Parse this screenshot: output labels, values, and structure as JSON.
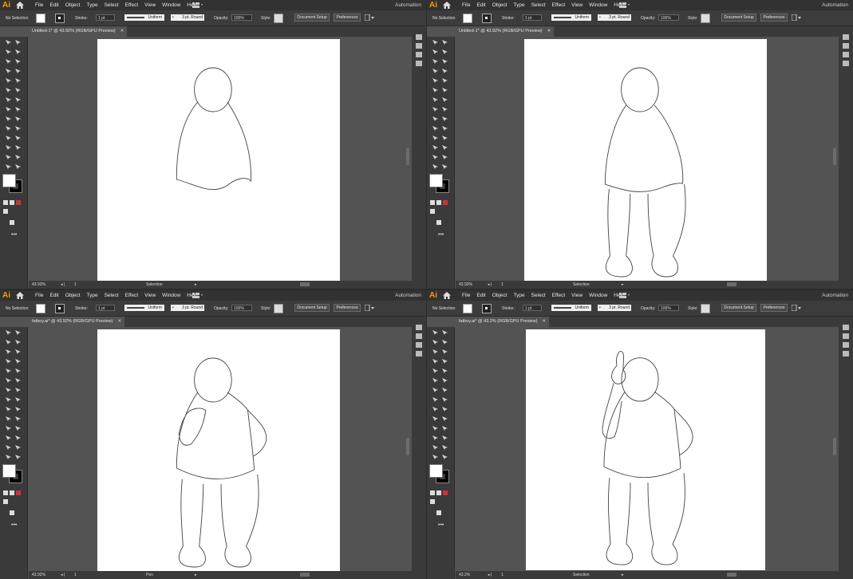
{
  "menu": [
    "File",
    "Edit",
    "Object",
    "Type",
    "Select",
    "Effect",
    "View",
    "Window",
    "Help"
  ],
  "app": {
    "logo": "Ai",
    "automation": "Automation"
  },
  "control": {
    "selection": "No Selection",
    "stroke_label": "Stroke:",
    "stroke_value": "1 pt",
    "profile": "Uniform",
    "brush": "3 pt. Round",
    "opacity_label": "Opacity:",
    "opacity_value": "100%",
    "style_label": "Style:",
    "doc_setup": "Document Setup",
    "preferences": "Preferences"
  },
  "more_tools": "•••",
  "panels": [
    {
      "tab": "Untitled-1* @ 43.92% (RGB/GPU Preview)",
      "zoom": "43.92%",
      "page": "1",
      "status": "Selection"
    },
    {
      "tab": "Untitled-1* @ 43.92% (RGB/GPU Preview)",
      "zoom": "43.92%",
      "page": "1",
      "status": "Selection"
    },
    {
      "tab": "fatboy.ai* @ 43.92% (RGB/GPU Preview)",
      "zoom": "43.92%",
      "page": "1",
      "status": "Pen"
    },
    {
      "tab": "fatboy.ai* @ 43.2% (RGB/GPU Preview)",
      "zoom": "43.2%",
      "page": "1",
      "status": "Selection"
    }
  ],
  "icons": [
    "home-icon",
    "workspace-switcher-icon",
    "selection-tool-icon",
    "direct-selection-tool-icon",
    "magic-wand-icon",
    "lasso-icon",
    "pen-tool-icon",
    "curvature-tool-icon",
    "type-tool-icon",
    "line-tool-icon",
    "ellipse-tool-icon",
    "paintbrush-icon",
    "shaper-tool-icon",
    "eraser-icon",
    "rotate-tool-icon",
    "scale-tool-icon",
    "width-tool-icon",
    "free-transform-icon",
    "shape-builder-icon",
    "perspective-grid-icon",
    "mesh-tool-icon",
    "gradient-tool-icon",
    "eyedropper-icon",
    "blend-tool-icon",
    "symbol-sprayer-icon",
    "graph-tool-icon",
    "artboard-tool-icon",
    "slice-tool-icon",
    "hand-tool-icon",
    "zoom-tool-icon",
    "fill-swatch-icon",
    "stroke-swatch-icon",
    "draw-mode-icon",
    "screen-mode-icon",
    "close-icon"
  ],
  "colors": {
    "accent": "#ff9a00",
    "panel_bg": "#535353",
    "chrome": "#323232",
    "artboard": "#ffffff"
  }
}
